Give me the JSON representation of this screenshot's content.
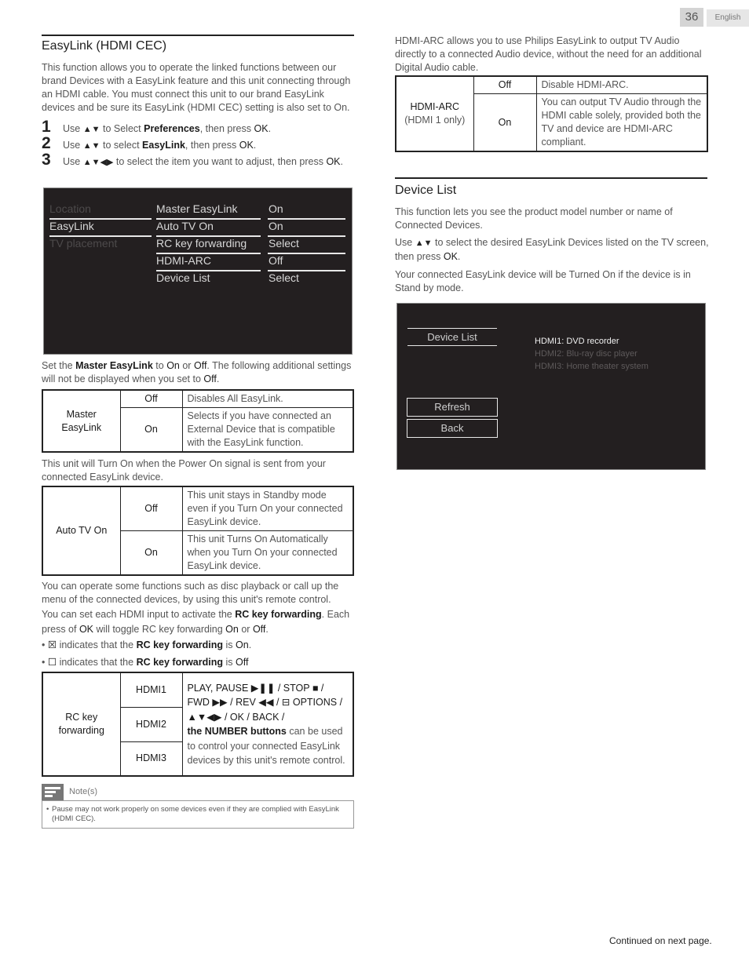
{
  "header": {
    "page_number": "36",
    "language": "English"
  },
  "easylink": {
    "title": "EasyLink (HDMI CEC)",
    "intro": "This function allows you to operate the linked functions between our brand Devices with a EasyLink feature and this unit connecting through an HDMI cable. You must connect this unit to our brand EasyLink devices and be sure its EasyLink (HDMI CEC) setting is also set to On.",
    "steps": [
      {
        "num": "1",
        "pre": "Use",
        "arrows": "▲▼",
        "mid": "to Select",
        "bold": "Preferences",
        "post": ", then press",
        "ok": "OK",
        "end": "."
      },
      {
        "num": "2",
        "pre": "Use",
        "arrows": "▲▼",
        "mid": "to select",
        "bold": "EasyLink",
        "post": ", then press",
        "ok": "OK",
        "end": "."
      },
      {
        "num": "3",
        "pre": "Use",
        "arrows": "▲▼◀▶",
        "mid": "to select the item you want to adjust, then press",
        "ok": "OK",
        "end": "."
      }
    ]
  },
  "tv_menu": {
    "left": [
      {
        "label": "Location",
        "state": "dim"
      },
      {
        "label": "EasyLink",
        "state": "selected"
      },
      {
        "label": "TV placement",
        "state": "dim"
      }
    ],
    "items": [
      {
        "label": "Master EasyLink",
        "value": "On"
      },
      {
        "label": "Auto TV On",
        "value": "On"
      },
      {
        "label": "RC key forwarding",
        "value": "Select"
      },
      {
        "label": "HDMI-ARC",
        "value": "Off"
      },
      {
        "label": "Device List",
        "value": "Select"
      }
    ]
  },
  "master": {
    "intro_parts": [
      "Set the",
      "Master EasyLink",
      "to",
      "On",
      "or",
      "Off",
      ". The following additional settings will not be displayed when you set to",
      "Off",
      "."
    ],
    "table": {
      "label": [
        "Master",
        "EasyLink"
      ],
      "rows": [
        {
          "option": "Off",
          "desc": "Disables All EasyLink."
        },
        {
          "option": "On",
          "desc": "Selects if you have connected an External Device that is compatible with the EasyLink function."
        }
      ]
    }
  },
  "auto_tv": {
    "intro": "This unit will Turn On when the Power On signal is sent from your connected EasyLink device.",
    "table": {
      "label": "Auto TV On",
      "rows": [
        {
          "option": "Off",
          "desc": "This unit stays in Standby mode even if you Turn On your connected EasyLink device."
        },
        {
          "option": "On",
          "desc": "This unit Turns On Automatically when you Turn On your connected EasyLink device."
        }
      ]
    }
  },
  "rc": {
    "para1": "You can operate some functions such as disc playback or call up the menu of the connected devices, by using this unit's remote control.",
    "para2_parts": [
      "You can set each HDMI input to activate the",
      "RC key forwarding",
      ". Each press of",
      "OK",
      "will toggle RC key forwarding",
      "On",
      "or",
      "Off",
      "."
    ],
    "bullets": [
      {
        "icon": "☒",
        "text": "indicates that the",
        "bold": "RC key forwarding",
        "is": "is",
        "state": "On",
        "end": "."
      },
      {
        "icon": "☐",
        "text": "indicates that the",
        "bold": "RC key forwarding",
        "is": "is",
        "state": "Off",
        "end": ""
      }
    ],
    "table": {
      "label": [
        "RC key",
        "forwarding"
      ],
      "inputs": [
        "HDMI1",
        "HDMI2",
        "HDMI3"
      ],
      "desc_line1": "PLAY, PAUSE ▶❚❚ / STOP ■ /",
      "desc_line2": "FWD ▶▶ / REV ◀◀ / ⊟ OPTIONS /",
      "desc_line3": "▲▼◀▶ / OK / BACK /",
      "desc_bold": "the NUMBER buttons",
      "desc_rest": "can be used to control your connected EasyLink devices by this unit's remote control."
    }
  },
  "note": {
    "title": "Note(s)",
    "items": [
      "Pause may not work properly on some devices even if they are complied with EasyLink (HDMI CEC)."
    ]
  },
  "hdmi_arc": {
    "intro": "HDMI-ARC allows you to use Philips EasyLink to output TV Audio directly to a connected Audio device, without the need for an additional Digital Audio cable.",
    "table": {
      "label": "HDMI-ARC",
      "sublabel": "(HDMI 1 only)",
      "rows": [
        {
          "option": "Off",
          "desc": "Disable HDMI-ARC."
        },
        {
          "option": "On",
          "desc": "You can output TV Audio through the HDMI cable solely, provided both the TV and device are HDMI-ARC compliant."
        }
      ]
    }
  },
  "device_list": {
    "title": "Device List",
    "para1": "This function lets you see the product model number or name of Connected Devices.",
    "para2_parts": [
      "Use",
      "▲▼",
      "to select the desired EasyLink Devices listed on the TV screen, then press",
      "OK",
      "."
    ],
    "para3": "Your connected EasyLink device will be Turned On if the device is in Stand by mode.",
    "screen": {
      "heading": "Device List",
      "devices": [
        {
          "label": "HDMI1: DVD recorder",
          "state": "selected"
        },
        {
          "label": "HDMI2: Blu-ray disc player",
          "state": "dim"
        },
        {
          "label": "HDMI3: Home theater system",
          "state": "dim"
        }
      ],
      "refresh_label": "Refresh",
      "back_label": "Back"
    }
  },
  "footer": {
    "continued": "Continued on next page."
  }
}
